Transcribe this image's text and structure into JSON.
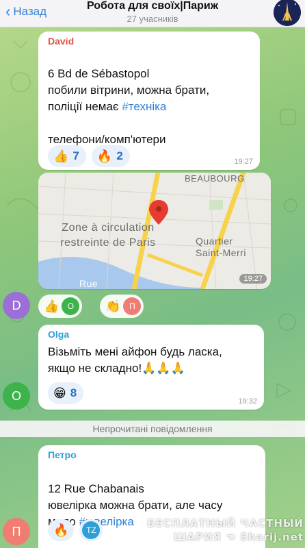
{
  "header": {
    "back_label": "Назад",
    "title": "Робота для своїх|Париж",
    "subtitle": "27 учасників",
    "group_avatar_icon": "eiffel-tower-night-icon"
  },
  "messages": [
    {
      "sender": "David",
      "sender_color": "#e0554b",
      "text_before": "6 Bd de Sébastopol\nпобили вітрини, можна брати,\nполіції немає ",
      "hashtag": "#техніка",
      "text_after": "\n\nтелефони/комп'ютери",
      "time": "19:27",
      "reactions": [
        {
          "icon": "thumbs-up-icon",
          "emoji": "👍",
          "count": "7"
        },
        {
          "icon": "fire-icon",
          "emoji": "🔥",
          "count": "2"
        }
      ]
    },
    {
      "type": "location",
      "map_labels": {
        "beaubourg": "BEAUBOURG",
        "zone": "Zone à circulation\nrestreinte de Paris",
        "quartier": "Quartier\nSaint-Merri",
        "rue": "Rue"
      },
      "time": "19:27",
      "sender_avatar_letter": "D",
      "sender_avatar_color": "#9b6fd6",
      "reactions": [
        {
          "icon": "thumbs-up-icon",
          "emoji": "👍",
          "reactor_letter": "O",
          "reactor_color": "#3cb44b"
        },
        {
          "icon": "clapping-icon",
          "emoji": "👏",
          "reactor_letter": "П",
          "reactor_color": "#f07c73"
        }
      ]
    },
    {
      "sender": "Olga",
      "sender_color": "#2e9fd8",
      "text": "Візьміть мені айфон будь ласка,\nякщо не складно!🙏🙏🙏",
      "time": "19:32",
      "avatar_letter": "O",
      "avatar_color": "#3cb44b",
      "reactions": [
        {
          "icon": "grinning-face-icon",
          "emoji": "😁",
          "count": "8"
        }
      ]
    },
    {
      "sender": "Петро",
      "sender_color": "#2e9fd8",
      "text_before": "12 Rue Chabanais\nювелірка можна брати, але часу\nмало ",
      "hashtag": "#ювелірка",
      "avatar_letter": "П",
      "avatar_color": "#f07c73",
      "reactions": [
        {
          "icon": "fire-icon",
          "emoji": "🔥"
        },
        {
          "icon": "reactor-avatar-icon",
          "reactor_letter": "TZ",
          "reactor_color": "#2e9fd8"
        }
      ]
    }
  ],
  "unread_divider": "Непрочитані повідомлення",
  "watermark": {
    "line1": "БЕСПЛАТНЫЙ ЧАСТНЫЙ",
    "line2": "ШАРИЯ",
    "line3": "Sharij.net"
  }
}
